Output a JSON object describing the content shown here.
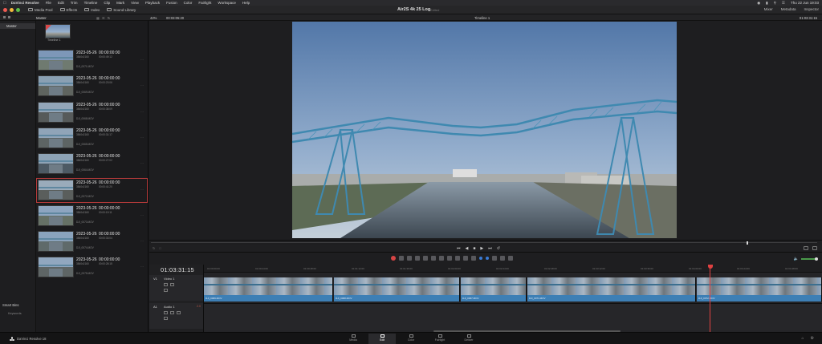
{
  "menubar": {
    "items": [
      "DaVinci Resolve",
      "File",
      "Edit",
      "Trim",
      "Timeline",
      "Clip",
      "Mark",
      "View",
      "Playback",
      "Fusion",
      "Color",
      "Fairlight",
      "Workspace",
      "Help"
    ],
    "datetime": "Thu 22 Jun  19:03"
  },
  "toolbar": {
    "media_pool": "Media Pool",
    "effects": "Effects",
    "index": "Index",
    "sound_library": "Sound Library",
    "project_title": "Air2S 4k 25 Log",
    "project_status": "Edited",
    "mixer": "Mixer",
    "metadata": "Metadata",
    "inspector": "Inspector"
  },
  "subbar": {
    "bin_name": "Master",
    "zoom": "42%",
    "source_timecode": "00:03:05:20",
    "timeline_name": "Timeline 1",
    "record_timecode": "01:03:31:15"
  },
  "sidebar": {
    "master": "Master",
    "smart_bins": "Smart Bins",
    "keywords": "Keywords"
  },
  "media_pool": {
    "timeline_thumb_label": "Timeline 1",
    "clips": [
      {
        "date": "2023-05-26",
        "tc": "00:00:00:00",
        "meta1": "3840x2160",
        "meta2": "00:00:49:12",
        "fname": "DJI_0071.MOV"
      },
      {
        "date": "2023-05-26",
        "tc": "00:00:00:00",
        "meta1": "3840x2160",
        "meta2": "00:00:23:06",
        "fname": "DJI_0069.MOV"
      },
      {
        "date": "2023-05-26",
        "tc": "00:00:00:00",
        "meta1": "3840x2160",
        "meta2": "00:00:38:09",
        "fname": "DJI_0068.MOV"
      },
      {
        "date": "2023-05-26",
        "tc": "00:00:00:00",
        "meta1": "3840x2160",
        "meta2": "00:00:31:17",
        "fname": "DJI_0065.MOV"
      },
      {
        "date": "2023-05-26",
        "tc": "00:00:00:00",
        "meta1": "3840x2160",
        "meta2": "00:00:27:02",
        "fname": "DJI_0064.MOV"
      },
      {
        "date": "2023-05-26",
        "tc": "00:00:00:00",
        "meta1": "3840x2160",
        "meta2": "00:00:41:20",
        "fname": "DJI_0072.MOV"
      },
      {
        "date": "2023-05-26",
        "tc": "00:00:00:00",
        "meta1": "3840x2160",
        "meta2": "00:00:19:11",
        "fname": "DJI_0073.MOV"
      },
      {
        "date": "2023-05-26",
        "tc": "00:00:00:00",
        "meta1": "3840x2160",
        "meta2": "00:00:33:04",
        "fname": "DJI_0074.MOV"
      },
      {
        "date": "2023-05-26",
        "tc": "00:00:00:00",
        "meta1": "3840x2160",
        "meta2": "00:00:28:15",
        "fname": "DJI_0075.MOV"
      }
    ]
  },
  "timeline": {
    "timecode": "01:03:31:15",
    "video_track": {
      "tag": "V1",
      "name": "Video 1"
    },
    "audio_track": {
      "tag": "A1",
      "name": "Audio 1",
      "count": "2.0"
    },
    "ruler_ticks": [
      "01:00:00:00",
      "01:00:24:00",
      "01:00:48:00",
      "01:01:12:00",
      "01:01:36:00",
      "01:02:00:00",
      "01:02:24:00",
      "01:02:48:00",
      "01:03:12:00",
      "01:03:36:00",
      "01:04:00:00",
      "01:04:24:00",
      "01:04:48:00"
    ],
    "clips": [
      {
        "label": "DJI_0069.MOV"
      },
      {
        "label": "DJI_0068.MOV"
      },
      {
        "label": "DJI_0067.MOV"
      },
      {
        "label": "DJI_0071.MOV"
      },
      {
        "label": "DJI_0072.MOV"
      }
    ]
  },
  "pagebar": {
    "brand": "DaVinci Resolve 18",
    "pages": [
      "Media",
      "Edit",
      "Color",
      "Fairlight",
      "Deliver"
    ],
    "active_page": "Edit"
  },
  "colors": {
    "accent_red": "#e04141",
    "clip_blue": "#3d7fb5",
    "selection": "#b43a3a"
  }
}
